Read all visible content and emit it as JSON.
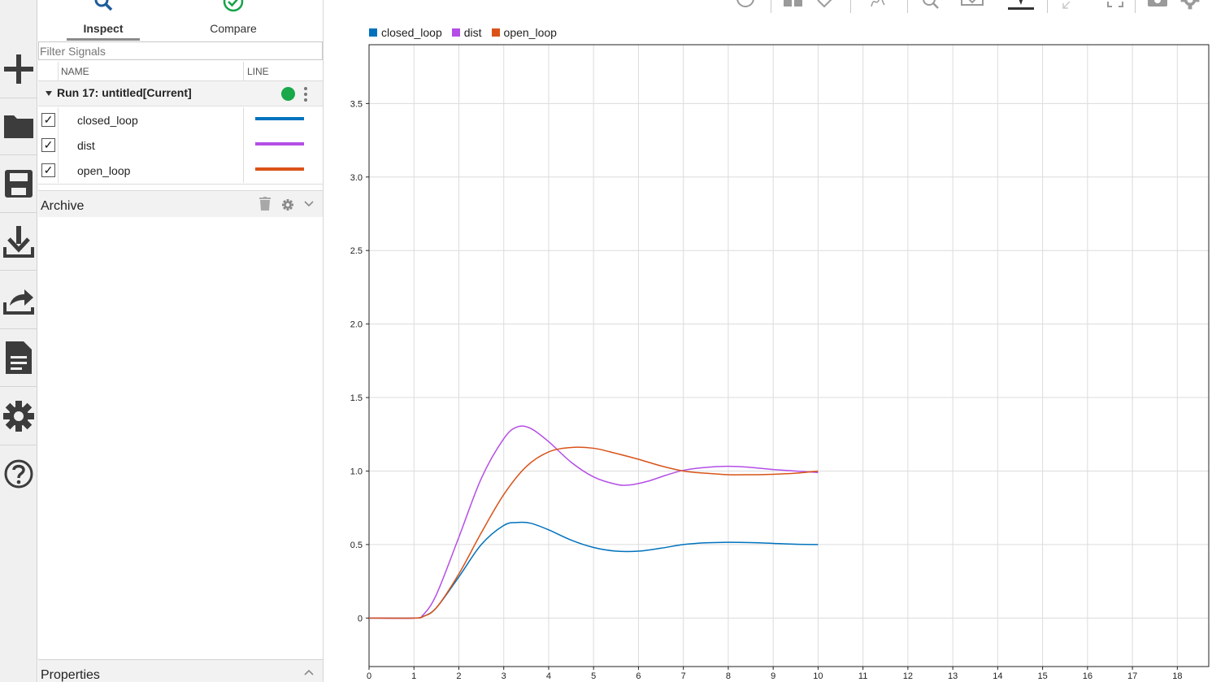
{
  "tabs": {
    "inspect": "Inspect",
    "compare": "Compare"
  },
  "filter": {
    "placeholder": "Filter Signals"
  },
  "columns": {
    "name": "NAME",
    "line": "LINE"
  },
  "run": {
    "label": "Run 17: untitled[Current]",
    "status_color": "#19a84a"
  },
  "signals": [
    {
      "name": "closed_loop",
      "checked": "✓",
      "color": "#0072bd"
    },
    {
      "name": "dist",
      "checked": "✓",
      "color": "#b44ee6"
    },
    {
      "name": "open_loop",
      "checked": "✓",
      "color": "#d95319"
    }
  ],
  "archive": {
    "label": "Archive"
  },
  "properties": {
    "label": "Properties"
  },
  "rail_icons": [
    "plus-icon",
    "folder-icon",
    "save-icon",
    "download-icon",
    "share-icon",
    "document-icon",
    "gear-icon",
    "help-icon"
  ],
  "chart_data": {
    "type": "line",
    "xlim": [
      0,
      18.7
    ],
    "ylim": [
      -0.33,
      3.9
    ],
    "grid": true,
    "legend_position": "top-left",
    "x_ticks": [
      0,
      1,
      2,
      3,
      4,
      5,
      6,
      7,
      8,
      9,
      10,
      11,
      12,
      13,
      14,
      15,
      16,
      17,
      18
    ],
    "y_ticks": [
      0,
      0.5,
      1.0,
      1.5,
      2.0,
      2.5,
      3.0,
      3.5
    ],
    "y_tick_labels": [
      "0",
      "0.5",
      "1.0",
      "1.5",
      "2.0",
      "2.5",
      "3.0",
      "3.5"
    ],
    "series": [
      {
        "name": "closed_loop",
        "color": "#0072bd",
        "x": [
          0,
          1,
          1.2,
          1.5,
          2,
          2.5,
          3,
          3.3,
          3.6,
          4,
          4.5,
          5,
          5.5,
          6,
          6.5,
          7,
          7.5,
          8,
          8.5,
          9,
          9.5,
          10
        ],
        "y": [
          0,
          0,
          0.01,
          0.07,
          0.28,
          0.5,
          0.63,
          0.65,
          0.645,
          0.6,
          0.53,
          0.48,
          0.455,
          0.455,
          0.475,
          0.5,
          0.512,
          0.515,
          0.513,
          0.508,
          0.502,
          0.5
        ]
      },
      {
        "name": "dist",
        "color": "#b44ee6",
        "x": [
          0,
          1,
          1.2,
          1.5,
          2,
          2.5,
          3,
          3.3,
          3.6,
          4,
          4.5,
          5,
          5.5,
          5.8,
          6.2,
          6.6,
          7,
          7.5,
          8,
          8.5,
          9,
          9.5,
          10
        ],
        "y": [
          0,
          0,
          0.02,
          0.16,
          0.55,
          0.95,
          1.22,
          1.3,
          1.29,
          1.2,
          1.06,
          0.96,
          0.91,
          0.905,
          0.93,
          0.97,
          1.005,
          1.025,
          1.032,
          1.025,
          1.01,
          1.0,
          0.99
        ]
      },
      {
        "name": "open_loop",
        "color": "#d95319",
        "x": [
          0,
          1,
          1.2,
          1.5,
          2,
          2.5,
          3,
          3.5,
          4,
          4.5,
          5,
          5.5,
          6,
          6.5,
          7,
          7.5,
          8,
          8.5,
          9,
          9.5,
          10
        ],
        "y": [
          0,
          0,
          0.01,
          0.07,
          0.3,
          0.58,
          0.84,
          1.03,
          1.13,
          1.16,
          1.155,
          1.12,
          1.08,
          1.035,
          1.0,
          0.985,
          0.975,
          0.975,
          0.978,
          0.985,
          1.0
        ]
      }
    ]
  }
}
